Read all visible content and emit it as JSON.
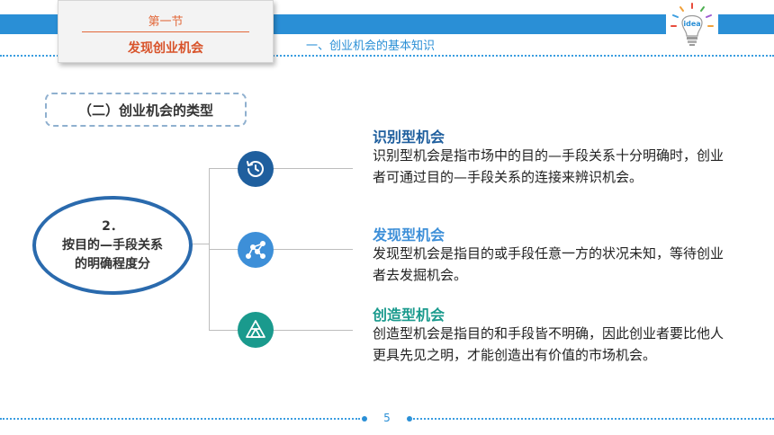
{
  "header": {
    "section_number": "第一节",
    "section_title": "发现创业机会",
    "subtitle": "一、创业机会的基本知识",
    "logo_word": "idea"
  },
  "main": {
    "category_label": "（二）创业机会的类型",
    "center": {
      "line1": "2．",
      "line2": "按目的—手段关系",
      "line3": "的明确程度分"
    },
    "items": [
      {
        "icon": "history-icon",
        "color": "#1f5f9e",
        "title": "识别型机会",
        "text": "识别型机会是指市场中的目的—手段关系十分明确时，创业者可通过目的—手段关系的连接来辨识机会。"
      },
      {
        "icon": "network-chart-icon",
        "color": "#3d8fd8",
        "title": "发现型机会",
        "text": "发现型机会是指目的或手段任意一方的状况未知，等待创业者去发掘机会。"
      },
      {
        "icon": "triangle-structure-icon",
        "color": "#1a9a8d",
        "title": "创造型机会",
        "text": "创造型机会是指目的和手段皆不明确，因此创业者要比他人更具先见之明，才能创造出有价值的市场机会。"
      }
    ]
  },
  "footer": {
    "page_number": "5"
  }
}
